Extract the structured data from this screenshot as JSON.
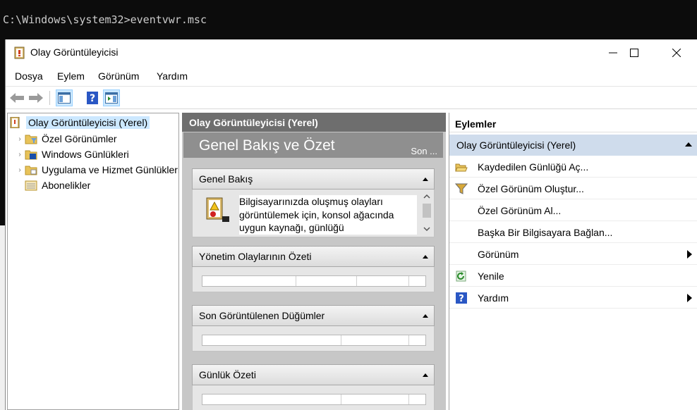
{
  "console": {
    "command": "C:\\Windows\\system32>eventvwr.msc"
  },
  "window": {
    "title": "Olay Görüntüleyicisi"
  },
  "menu": [
    "Dosya",
    "Eylem",
    "Görünüm",
    "Yardım"
  ],
  "tree": {
    "root": "Olay Görüntüleyicisi (Yerel)",
    "items": [
      "Özel Görünümler",
      "Windows Günlükleri",
      "Uygulama ve Hizmet Günlükleri",
      "Abonelikler"
    ]
  },
  "center": {
    "header": "Olay Görüntüleyicisi (Yerel)",
    "overview_title": "Genel Bakış ve Özet",
    "overview_more": "Son ...",
    "sections": {
      "overview": {
        "title": "Genel Bakış",
        "text": "Bilgisayarınızda oluşmuş olayları görüntülemek için, konsol ağacında uygun kaynağı, günlüğü"
      },
      "admin": {
        "title": "Yönetim Olaylarının Özeti"
      },
      "recent": {
        "title": "Son Görüntülenen Düğümler"
      },
      "log": {
        "title": "Günlük Özeti"
      }
    }
  },
  "actions": {
    "header": "Eylemler",
    "group": "Olay Görüntüleyicisi (Yerel)",
    "items": [
      {
        "label": "Kaydedilen Günlüğü Aç...",
        "icon": "open-folder-icon"
      },
      {
        "label": "Özel Görünüm Oluştur...",
        "icon": "filter-icon"
      },
      {
        "label": "Özel Görünüm Al...",
        "icon": ""
      },
      {
        "label": "Başka Bir Bilgisayara Bağlan...",
        "icon": ""
      },
      {
        "label": "Görünüm",
        "icon": "",
        "submenu": true
      },
      {
        "label": "Yenile",
        "icon": "refresh-icon"
      },
      {
        "label": "Yardım",
        "icon": "help-icon",
        "submenu": true
      }
    ]
  },
  "colors": {
    "selection": "#cce8ff",
    "actions_group": "#cfdcec",
    "center_header": "#6e6e6e"
  }
}
